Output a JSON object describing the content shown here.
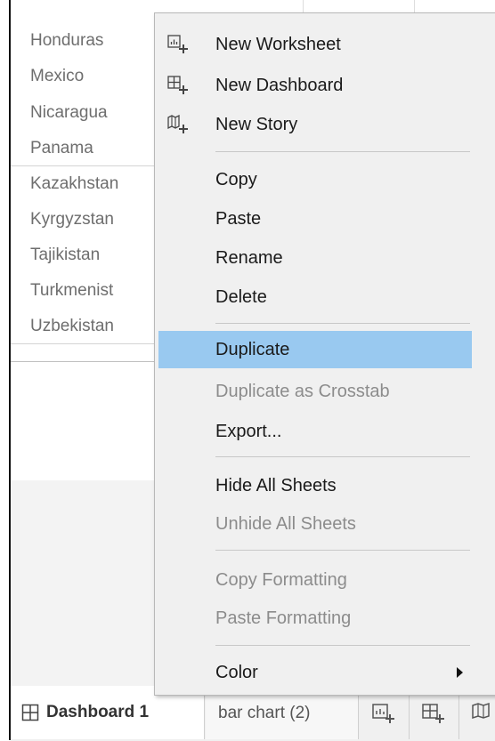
{
  "background_list": {
    "items": [
      "Honduras",
      "Mexico",
      "Nicaragua",
      "Panama",
      "Kazakhstan",
      "Kyrgyzstan",
      "Tajikistan",
      "Turkmenist",
      "Uzbekistan"
    ]
  },
  "context_menu": {
    "items": [
      {
        "label": "New Worksheet",
        "icon": "new-worksheet-icon",
        "disabled": false
      },
      {
        "label": "New Dashboard",
        "icon": "new-dashboard-icon",
        "disabled": false
      },
      {
        "label": "New Story",
        "icon": "new-story-icon",
        "disabled": false
      },
      {
        "label": "Copy",
        "disabled": false
      },
      {
        "label": "Paste",
        "disabled": false
      },
      {
        "label": "Rename",
        "disabled": false
      },
      {
        "label": "Delete",
        "disabled": false
      },
      {
        "label": "Duplicate",
        "disabled": false,
        "highlighted": true
      },
      {
        "label": "Duplicate as Crosstab",
        "disabled": true
      },
      {
        "label": "Export...",
        "disabled": false
      },
      {
        "label": "Hide All Sheets",
        "disabled": false
      },
      {
        "label": "Unhide All Sheets",
        "disabled": true
      },
      {
        "label": "Copy Formatting",
        "disabled": true
      },
      {
        "label": "Paste Formatting",
        "disabled": true
      },
      {
        "label": "Color",
        "disabled": false,
        "submenu": true
      }
    ]
  },
  "tabs": {
    "active": {
      "label": "Dashboard 1",
      "icon": "dashboard-icon"
    },
    "second": {
      "label": "bar chart (2)"
    },
    "icons": [
      "new-worksheet-icon",
      "new-dashboard-icon",
      "new-story-icon"
    ]
  },
  "colors": {
    "highlight": "#99c9f0",
    "menu_bg": "#f0f0f0",
    "disabled_text": "#8c8c8c"
  }
}
